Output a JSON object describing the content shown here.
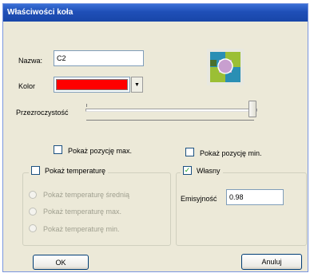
{
  "window": {
    "title": "Właściwości koła"
  },
  "form": {
    "name_label": "Nazwa:",
    "name_value": "C2",
    "color_label": "Kolor",
    "color_value": "#ff0000",
    "transparency_label": "Przezroczystość",
    "transparency_level_percent": 100
  },
  "options": {
    "show_max_position": "Pokaż pozycję max.",
    "show_min_position": "Pokaż pozycję min.",
    "show_temperature": "Pokaż temperaturę",
    "temp_avg": "Pokaż temperaturę średnią",
    "temp_max": "Pokaż temperaturę max.",
    "temp_min": "Pokaż temperaturę min.",
    "own_label": "Własny",
    "own_checked": true,
    "emissivity_label": "Emisyjność",
    "emissivity_value": "0.98"
  },
  "buttons": {
    "ok": "OK",
    "cancel": "Anuluj"
  },
  "icon": {
    "name": "circle-grid-icon",
    "colors": [
      "#2a8fb4",
      "#9bbf35",
      "#c89fcf",
      "#4a6f2d"
    ]
  }
}
